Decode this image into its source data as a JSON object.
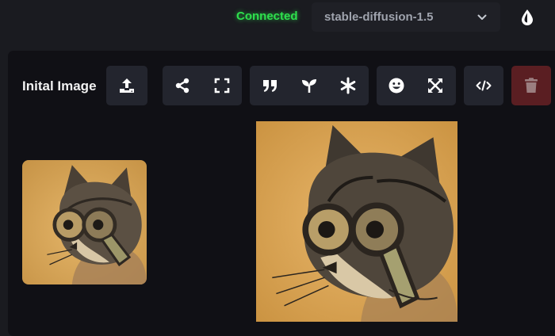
{
  "header": {
    "status": "Connected",
    "status_color": "#2ee04d",
    "model": "stable-diffusion-1.5",
    "model_dropdown_icon": "chevron-down-icon",
    "theme_icon": "droplet-icon"
  },
  "panel": {
    "title": "Inital Image",
    "toolbar": [
      {
        "group": "upload",
        "icons": [
          "upload-icon"
        ]
      },
      {
        "group": "view",
        "icons": [
          "share-icon",
          "fullscreen-icon"
        ]
      },
      {
        "group": "params",
        "icons": [
          "quote-icon",
          "seedling-icon",
          "asterisk-icon"
        ]
      },
      {
        "group": "restore",
        "icons": [
          "face-smile-icon",
          "expand-arrows-icon"
        ]
      },
      {
        "group": "code",
        "icons": [
          "code-icon"
        ]
      },
      {
        "group": "delete",
        "icons": [
          "trash-icon"
        ]
      }
    ],
    "delete_color": "#5a1e22",
    "thumbnail": "cat-with-glasses-sketch-thumbnail",
    "main_image": "cat-with-glasses-sketch"
  }
}
